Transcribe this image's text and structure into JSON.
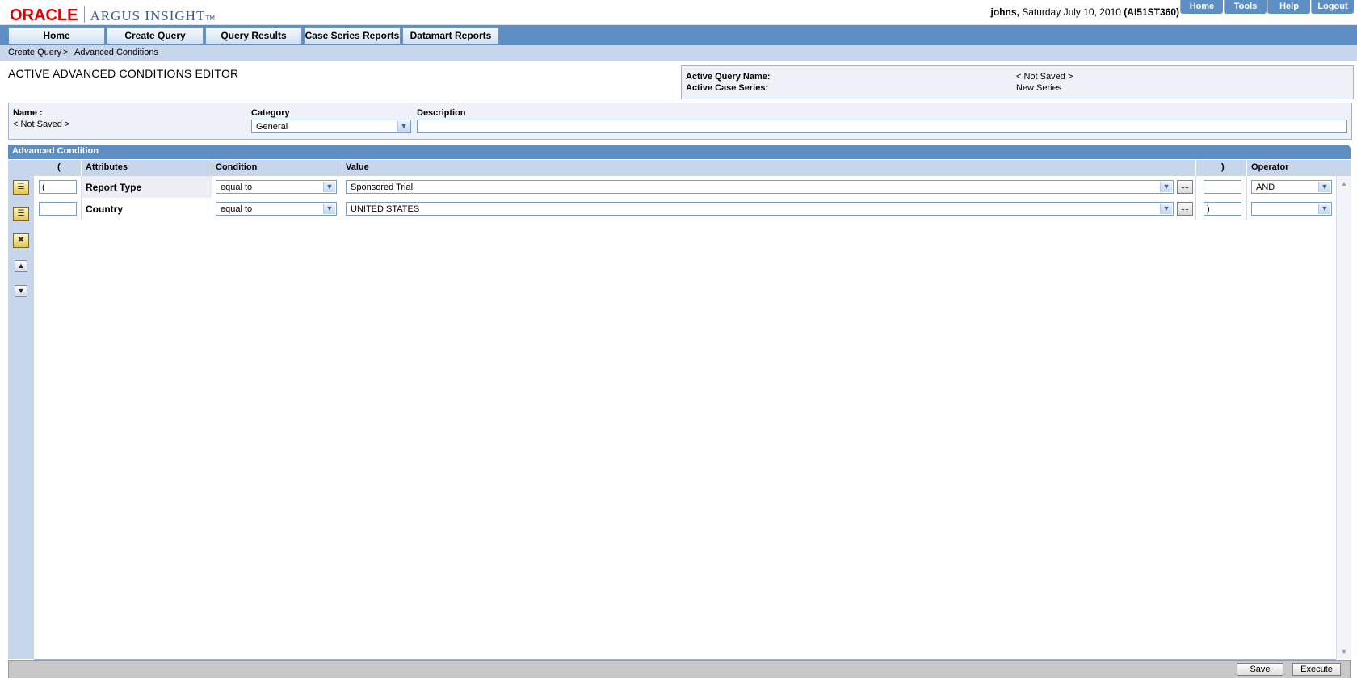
{
  "header": {
    "logo_oracle": "ORACLE",
    "logo_product": "ARGUS INSIGHT",
    "logo_tm": "TM",
    "user": "johns,",
    "date": "Saturday July 10, 2010",
    "server": "(AI51ST360)",
    "global_nav": [
      "Home",
      "Tools",
      "Help",
      "Logout"
    ]
  },
  "tabs": [
    "Home",
    "Create Query",
    "Query Results",
    "Case Series Reports",
    "Datamart Reports"
  ],
  "breadcrumb": {
    "item1": "Create Query",
    "sep": ">",
    "item2": "Advanced Conditions"
  },
  "page_title": "ACTIVE ADVANCED CONDITIONS EDITOR",
  "info": {
    "query_name_label": "Active Query Name:",
    "query_name_value": "< Not Saved >",
    "case_series_label": "Active Case Series:",
    "case_series_value": "New Series"
  },
  "meta": {
    "name_label": "Name :",
    "name_value": "< Not Saved >",
    "category_label": "Category",
    "category_value": "General",
    "description_label": "Description",
    "description_value": ""
  },
  "advanced_condition": {
    "title": "Advanced Condition",
    "columns": {
      "open_paren": "(",
      "attributes": "Attributes",
      "condition": "Condition",
      "value": "Value",
      "close_paren": ")",
      "operator": "Operator"
    },
    "rows": [
      {
        "open": "(",
        "attribute": "Report Type",
        "condition": "equal to",
        "value": "Sponsored Trial",
        "close": "",
        "operator": "AND"
      },
      {
        "open": "",
        "attribute": "Country",
        "condition": "equal to",
        "value": "UNITED STATES",
        "close": ")",
        "operator": ""
      }
    ],
    "lookup_label": "...."
  },
  "footer": {
    "save": "Save",
    "execute": "Execute"
  }
}
